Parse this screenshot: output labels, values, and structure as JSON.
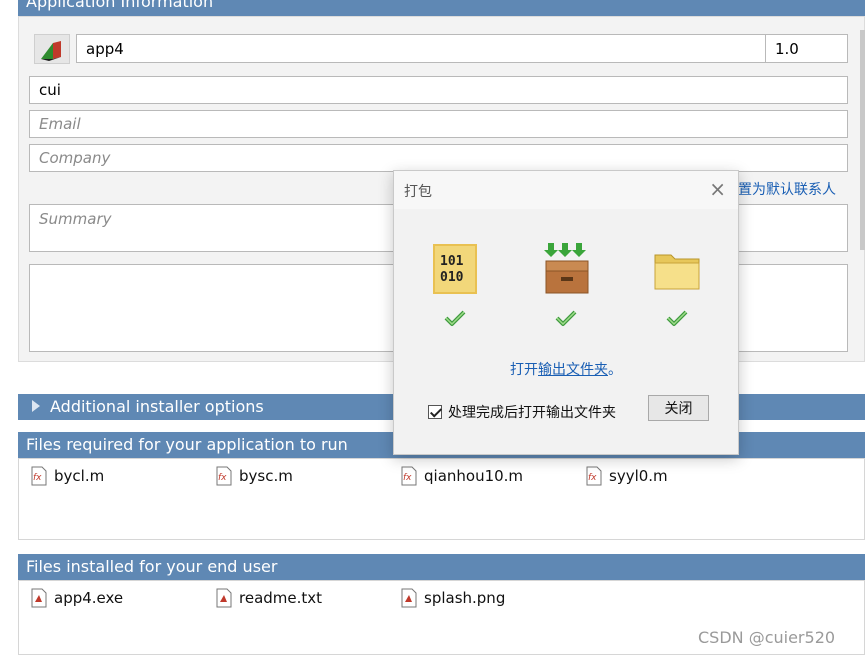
{
  "app_info": {
    "section_title": "Application Information",
    "app_name": "app4",
    "version": "1.0",
    "author": "cui",
    "email_placeholder": "Email",
    "company_placeholder": "Company",
    "set_default_contact": "设置为默认联系人",
    "summary_placeholder": "Summary"
  },
  "additional_options": {
    "label": "Additional installer options"
  },
  "files_required": {
    "title": "Files required for your application to run",
    "items": [
      "bycl.m",
      "bysc.m",
      "qianhou10.m",
      "syyl0.m"
    ]
  },
  "files_installed": {
    "title": "Files installed for your end user",
    "items": [
      "app4.exe",
      "readme.txt",
      "splash.png"
    ]
  },
  "dialog": {
    "title": "打包",
    "link_prefix": "打开",
    "link_text": "输出文件夹",
    "link_suffix": "。",
    "checkbox_label": "处理完成后打开输出文件夹",
    "checkbox_checked": true,
    "close_button": "关闭",
    "close_icon": "×"
  },
  "watermark": "CSDN @cuier520",
  "icon_names": [
    "app-logo-icon",
    "binary-file-icon",
    "package-box-icon",
    "folder-icon",
    "check-icon",
    "matlab-file-icon",
    "expand-arrow-icon"
  ],
  "colors": {
    "header_blue": "#5f88b4",
    "link_blue": "#1a5fb4"
  }
}
